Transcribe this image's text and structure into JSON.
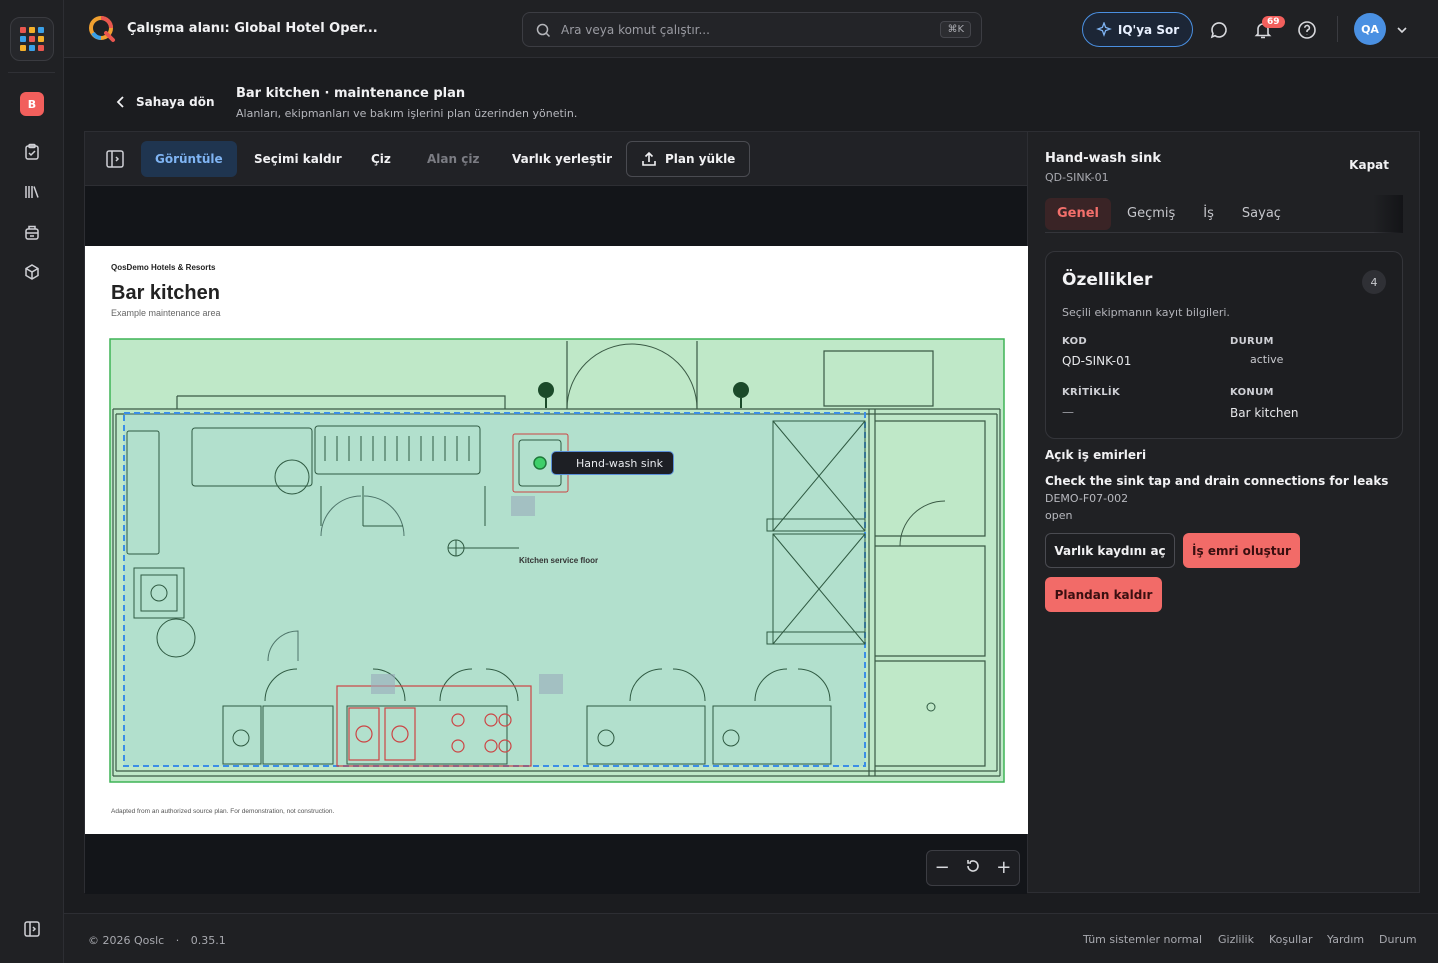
{
  "app": {
    "workspace_title": "Çalışma alanı: Global Hotel Oper...",
    "workspace_initial": "B"
  },
  "search": {
    "placeholder": "Ara veya komut çalıştır...",
    "shortcut": "⌘K"
  },
  "topbar": {
    "ask_label": "IQ'ya Sor",
    "notification_count": "69",
    "avatar_initials": "QA"
  },
  "page": {
    "back_label": "Sahaya dön",
    "title": "Bar kitchen · maintenance plan",
    "subtitle": "Alanları, ekipmanları ve bakım işlerini plan üzerinden yönetin."
  },
  "toolbar": {
    "view": "Görüntüle",
    "clear_selection": "Seçimi kaldır",
    "draw": "Çiz",
    "draw_area": "Alan çiz",
    "place_asset": "Varlık yerleştir",
    "upload_plan": "Plan yükle"
  },
  "plan": {
    "brand": "QosDemo Hotels & Resorts",
    "title": "Bar kitchen",
    "subtitle": "Example maintenance area",
    "zone_label": "Kitchen service floor",
    "tooltip": "Hand-wash sink",
    "footnote": "Adapted from an authorized source plan. For demonstration, not construction."
  },
  "details": {
    "title": "Hand-wash sink",
    "code": "QD-SINK-01",
    "close_label": "Kapat",
    "tabs": [
      "Genel",
      "Geçmiş",
      "İş",
      "Sayaç"
    ],
    "properties": {
      "heading": "Özellikler",
      "count": "4",
      "description": "Seçili ekipmanın kayıt bilgileri.",
      "code_label": "KOD",
      "code_value": "QD-SINK-01",
      "status_label": "DURUM",
      "status_value": "active",
      "criticality_label": "KRİTİKLİK",
      "criticality_value": "—",
      "location_label": "KONUM",
      "location_value": "Bar kitchen"
    },
    "open_work_orders_heading": "Açık iş emirleri",
    "work_order": {
      "title": "Check the sink tap and drain connections for leaks",
      "id": "DEMO-F07-002",
      "status": "open"
    },
    "buttons": {
      "open_record": "Varlık kaydını aç",
      "create_wo": "İş emri oluştur",
      "remove": "Plandan kaldır"
    }
  },
  "footer": {
    "copyright": "© 2026 Qoslc",
    "version": "0.35.1",
    "status": "Tüm sistemler normal",
    "links": [
      "Gizlilik",
      "Koşullar",
      "Yardım",
      "Durum"
    ]
  },
  "colors": {
    "accent_red": "#f26b68",
    "accent_blue": "#4a90e2",
    "zone_green": "#bfe8c8",
    "selection_blue": "#3b8ee6"
  }
}
